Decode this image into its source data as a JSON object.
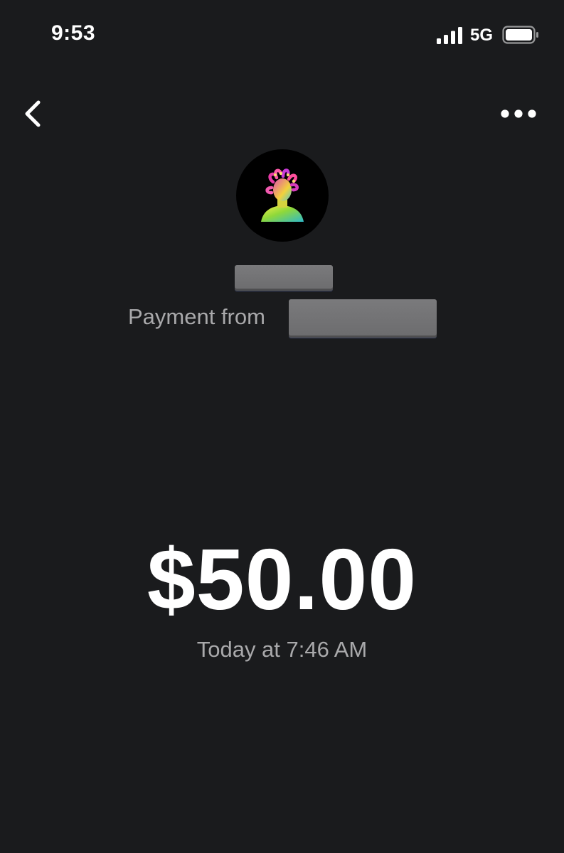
{
  "status_bar": {
    "time": "9:53",
    "network": "5G",
    "signal_icon": "cellular-signal-icon",
    "battery_icon": "battery-icon"
  },
  "nav": {
    "back_icon": "chevron-left-icon",
    "more_icon": "ellipsis-horizontal-icon"
  },
  "payment": {
    "avatar_icon": "medusa-bust-avatar",
    "from_label": "Payment from",
    "amount": "$50.00",
    "date": "Today at 7:46 AM"
  },
  "colors": {
    "background": "#1a1b1d",
    "primary_text": "#ffffff",
    "secondary_text": "#a9a9ab",
    "redaction": "#757577"
  }
}
